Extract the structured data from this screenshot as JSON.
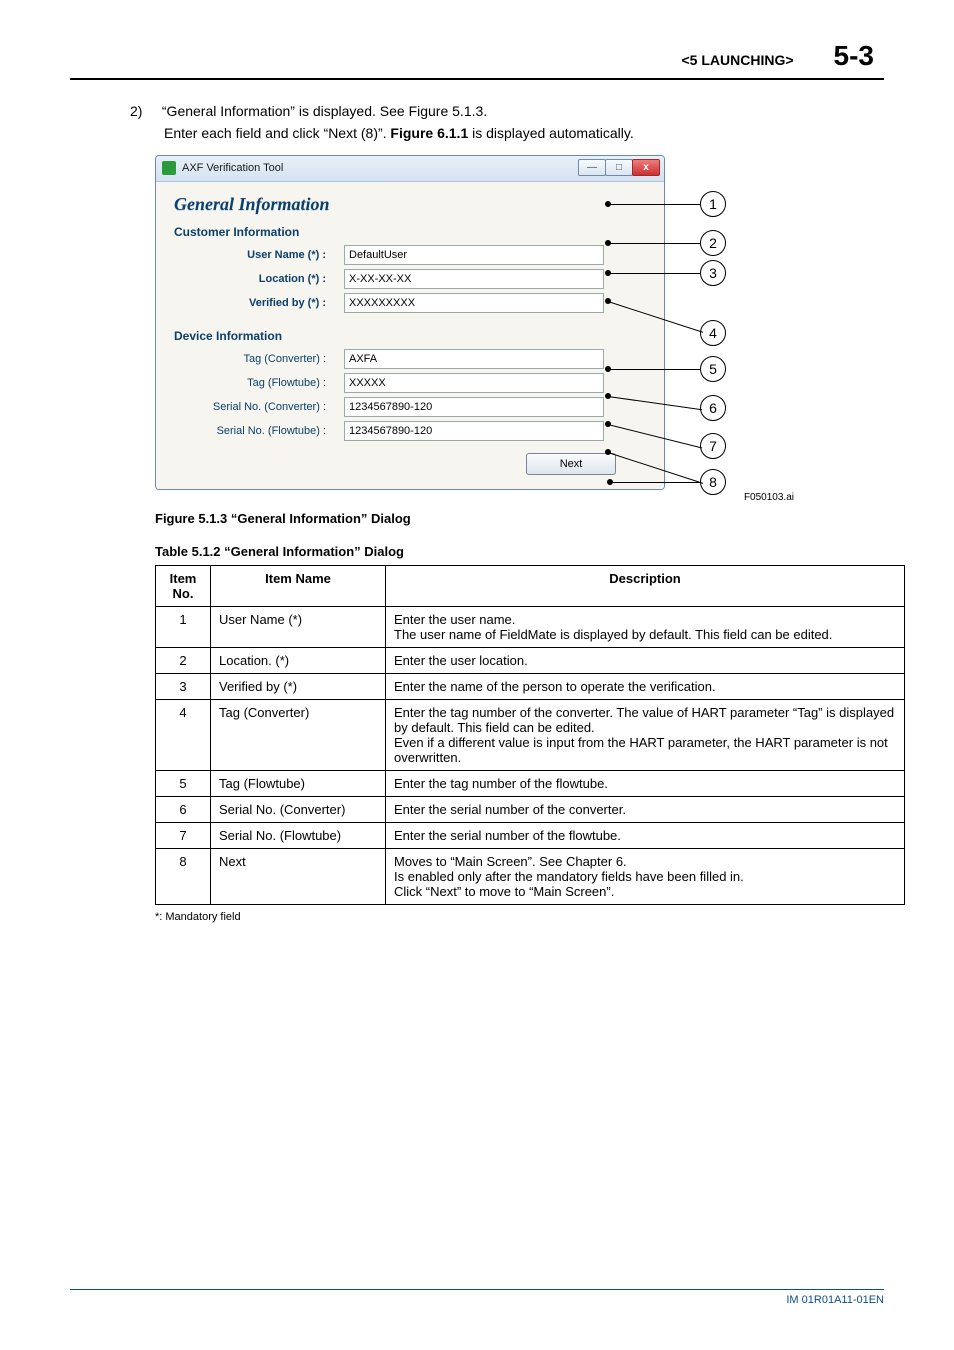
{
  "header": {
    "chapter": "<5  LAUNCHING>",
    "page": "5-3"
  },
  "body": {
    "step_num": "2)",
    "step_text_a": "“General Information” is displayed. See Figure 5.1.3.",
    "step_text_b_1": "Enter each field and click “Next (8)”. ",
    "step_text_b_bold": "Figure 6.1.1",
    "step_text_b_2": " is displayed automatically."
  },
  "dialog": {
    "window_title": "AXF Verification Tool",
    "heading": "General Information",
    "section_customer": "Customer Information",
    "section_device": "Device Information",
    "fields": {
      "user_name_label": "User Name (*) :",
      "user_name_value": "DefaultUser",
      "location_label": "Location (*) :",
      "location_value": "X-XX-XX-XX",
      "verified_label": "Verified by (*) :",
      "verified_value": "XXXXXXXXX",
      "tag_conv_label": "Tag (Converter) :",
      "tag_conv_value": "AXFA",
      "tag_flow_label": "Tag (Flowtube) :",
      "tag_flow_value": "XXXXX",
      "sn_conv_label": "Serial No. (Converter) :",
      "sn_conv_value": "1234567890-120",
      "sn_flow_label": "Serial No. (Flowtube) :",
      "sn_flow_value": "1234567890-120"
    },
    "next": "Next"
  },
  "figure": {
    "id": "F050103.ai",
    "caption": "Figure 5.1.3 “General Information” Dialog"
  },
  "table": {
    "caption": "Table 5.1.2 “General Information” Dialog",
    "head_no": "Item No.",
    "head_name": "Item Name",
    "head_desc": "Description",
    "rows": [
      {
        "no": "1",
        "name": "User Name (*)",
        "desc": "Enter the user name.\nThe user name of FieldMate is displayed by default. This field can be edited."
      },
      {
        "no": "2",
        "name": "Location. (*)",
        "desc": "Enter the user location."
      },
      {
        "no": "3",
        "name": "Verified by (*)",
        "desc": "Enter the name of the person to operate the verification."
      },
      {
        "no": "4",
        "name": "Tag (Converter)",
        "desc": "Enter the tag number of the converter. The value of HART parameter “Tag” is displayed by default. This field can be edited.\nEven if a different value is input from the HART parameter, the HART parameter is not overwritten."
      },
      {
        "no": "5",
        "name": "Tag (Flowtube)",
        "desc": "Enter the tag number of the flowtube."
      },
      {
        "no": "6",
        "name": "Serial No. (Converter)",
        "desc": "Enter the serial number of the converter."
      },
      {
        "no": "7",
        "name": "Serial No. (Flowtube)",
        "desc": "Enter the serial number of the flowtube."
      },
      {
        "no": "8",
        "name": "Next",
        "desc": "Moves to “Main Screen”. See Chapter 6.\nIs enabled only after the mandatory fields have been filled in.\nClick “Next” to move to “Main Screen”."
      }
    ],
    "footnote": "*: Mandatory field"
  },
  "footer": {
    "doc_id": "IM 01R01A11-01EN"
  },
  "callouts": [
    "1",
    "2",
    "3",
    "4",
    "5",
    "6",
    "7",
    "8"
  ]
}
